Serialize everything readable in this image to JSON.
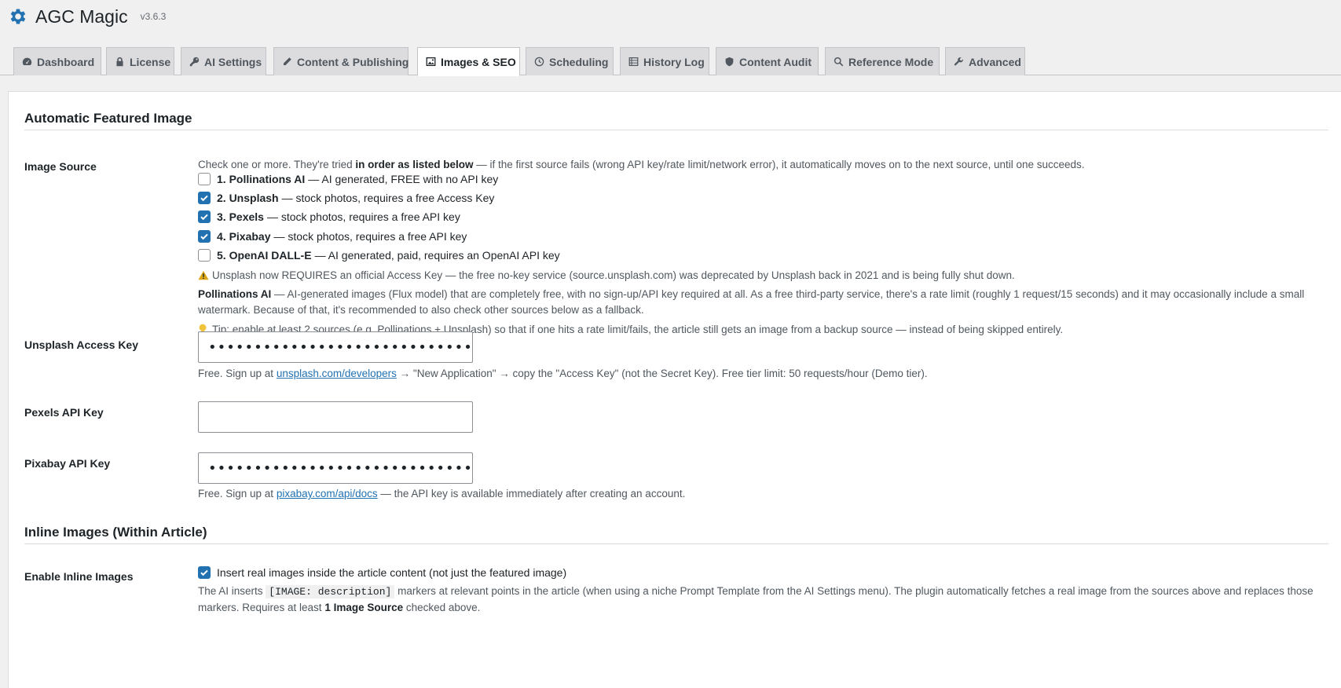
{
  "app": {
    "title": "AGC Magic",
    "version": "v3.6.3"
  },
  "tabs": [
    {
      "label": "Dashboard",
      "icon": "dashboard-icon"
    },
    {
      "label": "License",
      "icon": "lock-icon"
    },
    {
      "label": "AI Settings",
      "icon": "key-icon"
    },
    {
      "label": "Content & Publishing",
      "icon": "pencil-icon"
    },
    {
      "label": "Images & SEO",
      "icon": "image-icon",
      "active": true
    },
    {
      "label": "Scheduling",
      "icon": "clock-icon"
    },
    {
      "label": "History Log",
      "icon": "list-icon"
    },
    {
      "label": "Content Audit",
      "icon": "shield-icon"
    },
    {
      "label": "Reference Mode",
      "icon": "search-icon"
    },
    {
      "label": "Advanced",
      "icon": "wrench-icon"
    }
  ],
  "featured": {
    "heading": "Automatic Featured Image",
    "image_source": {
      "label": "Image Source",
      "intro_pre": "Check one or more. They're tried ",
      "intro_bold": "in order as listed below",
      "intro_post": " — if the first source fails (wrong API key/rate limit/network error), it automatically moves on to the next source, until one succeeds.",
      "options": [
        {
          "name": "1. Pollinations AI",
          "desc": "— AI generated, FREE with no API key",
          "checked": false
        },
        {
          "name": "2. Unsplash",
          "desc": "— stock photos, requires a free Access Key",
          "checked": true
        },
        {
          "name": "3. Pexels",
          "desc": "— stock photos, requires a free API key",
          "checked": true
        },
        {
          "name": "4. Pixabay",
          "desc": "— stock photos, requires a free API key",
          "checked": true
        },
        {
          "name": "5. OpenAI DALL-E",
          "desc": "— AI generated, paid, requires an OpenAI API key",
          "checked": false
        }
      ],
      "warning": "Unsplash now REQUIRES an official Access Key — the free no-key service (source.unsplash.com) was deprecated by Unsplash back in 2021 and is being fully shut down.",
      "pollinations_bold": "Pollinations AI",
      "pollinations_text": " — AI-generated images (Flux model) that are completely free, with no sign-up/API key required at all. As a free third-party service, there's a rate limit (roughly 1 request/15 seconds) and it may occasionally include a small watermark. Because of that, it's recommended to also check other sources below as a fallback.",
      "tip": "Tip: enable at least 2 sources (e.g. Pollinations + Unsplash) so that if one hits a rate limit/fails, the article still gets an image from a backup source — instead of being skipped entirely."
    },
    "unsplash": {
      "label": "Unsplash Access Key",
      "value": "•••••••••••••••••••••••••••••••••••••••••••",
      "help_pre": "Free. Sign up at ",
      "help_link": "unsplash.com/developers",
      "help_post": " → \"New Application\" → copy the \"Access Key\" (not the Secret Key). Free tier limit: 50 requests/hour (Demo tier)."
    },
    "pexels": {
      "label": "Pexels API Key",
      "value": ""
    },
    "pixabay": {
      "label": "Pixabay API Key",
      "value": "••••••••••••••••••••••••••••••••••",
      "help_pre": "Free. Sign up at ",
      "help_link": "pixabay.com/api/docs",
      "help_post": " — the API key is available immediately after creating an account."
    }
  },
  "inline": {
    "heading": "Inline Images (Within Article)",
    "enable": {
      "label": "Enable Inline Images",
      "checkbox_label": "Insert real images inside the article content (not just the featured image)",
      "checked": true,
      "desc_pre": "The AI inserts ",
      "desc_code": "[IMAGE: description]",
      "desc_mid": " markers at relevant points in the article (when using a niche Prompt Template from the AI Settings menu). The plugin automatically fetches a real image from the sources above and replaces those markers. Requires at least ",
      "desc_bold": "1 Image Source",
      "desc_post": " checked above."
    }
  },
  "colors": {
    "accent": "#2271b1",
    "warning": "#dba617",
    "tip": "#f0c33c"
  }
}
